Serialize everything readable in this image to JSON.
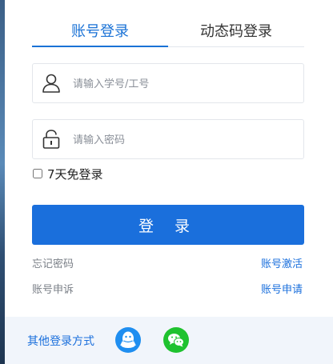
{
  "tabs": [
    {
      "label": "账号登录",
      "active": true
    },
    {
      "label": "动态码登录",
      "active": false
    }
  ],
  "username": {
    "placeholder": "请输入学号/工号",
    "value": "",
    "icon": "user-icon"
  },
  "password": {
    "placeholder": "请输入密码",
    "value": "",
    "icon": "lock-icon"
  },
  "remember": {
    "label": "7天免登录",
    "checked": false
  },
  "login_button": {
    "label": "登 录"
  },
  "links": {
    "forgot": "忘记密码",
    "activate": "账号激活",
    "appeal": "账号申诉",
    "apply": "账号申请"
  },
  "footer": {
    "label": "其他登录方式",
    "providers": [
      "qq-icon",
      "wechat-icon"
    ]
  },
  "colors": {
    "accent": "#1a6fdc",
    "footer_bg": "#f1f5fb",
    "wechat": "#1fc22f",
    "qq": "#1f8ef0"
  }
}
